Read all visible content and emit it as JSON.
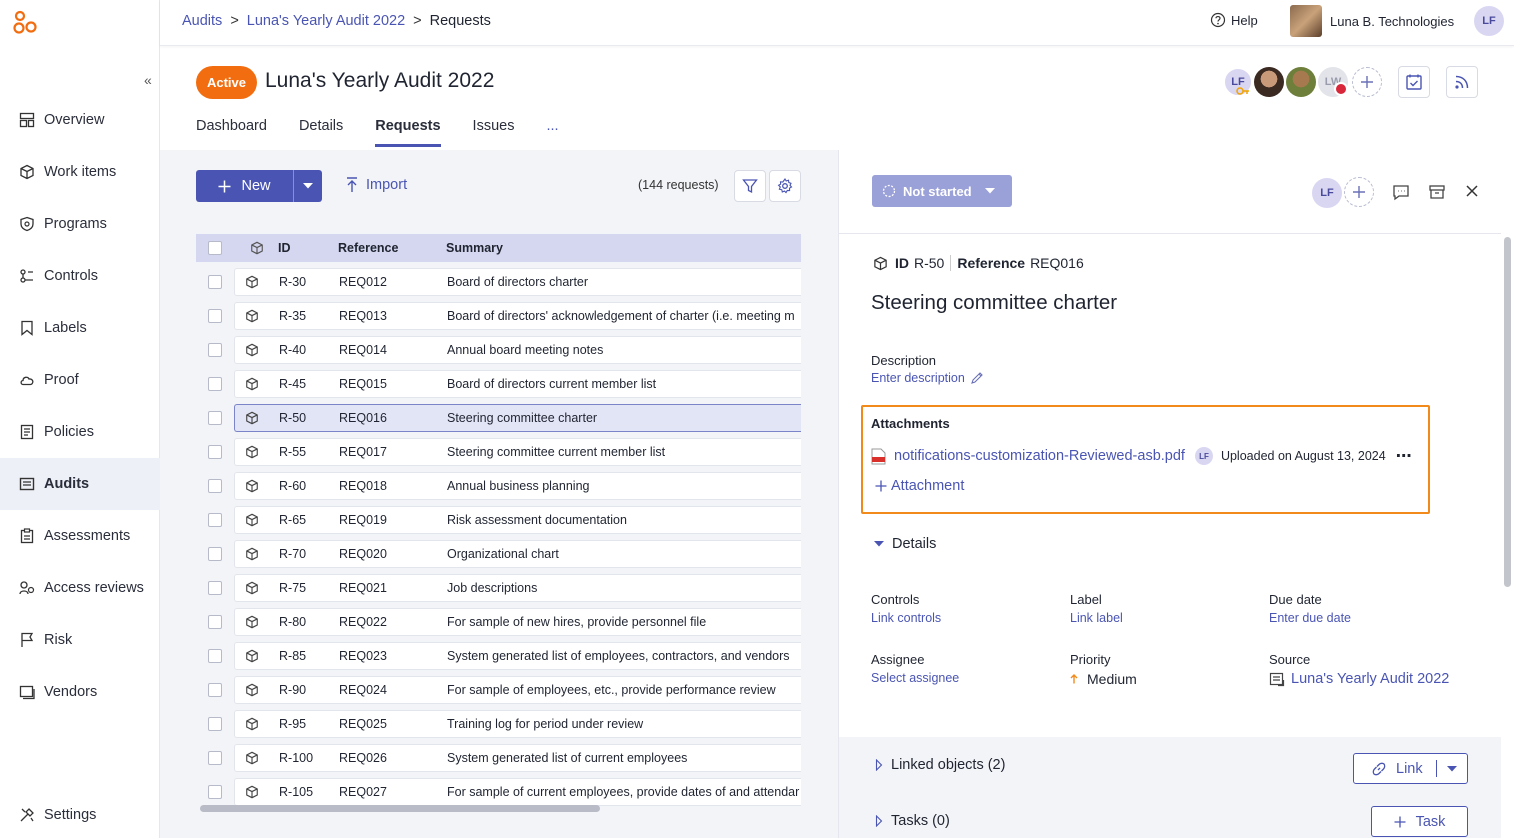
{
  "colors": {
    "accent": "#4a55b3",
    "active_badge": "#f26d10",
    "highlight": "#f28a1b",
    "status": "#9aa0d8"
  },
  "sidebar": {
    "collapse_icon": "«",
    "items": [
      {
        "label": "Overview",
        "icon": "overview-icon"
      },
      {
        "label": "Work items",
        "icon": "cube-icon"
      },
      {
        "label": "Programs",
        "icon": "shield-icon"
      },
      {
        "label": "Controls",
        "icon": "controls-icon"
      },
      {
        "label": "Labels",
        "icon": "bookmark-icon"
      },
      {
        "label": "Proof",
        "icon": "cloud-icon"
      },
      {
        "label": "Policies",
        "icon": "policy-icon"
      },
      {
        "label": "Audits",
        "icon": "audit-icon",
        "active": true
      },
      {
        "label": "Assessments",
        "icon": "clipboard-icon"
      },
      {
        "label": "Access reviews",
        "icon": "access-icon"
      },
      {
        "label": "Risk",
        "icon": "flag-icon"
      },
      {
        "label": "Vendors",
        "icon": "vendor-icon"
      }
    ],
    "settings": "Settings"
  },
  "topbar": {
    "breadcrumb": [
      "Audits",
      "Luna's Yearly Audit 2022",
      "Requests"
    ],
    "sep": ">",
    "help": "Help",
    "org": "Luna B. Technologies",
    "user_initials": "LF"
  },
  "header": {
    "status": "Active",
    "title": "Luna's Yearly Audit 2022",
    "tabs": [
      "Dashboard",
      "Details",
      "Requests",
      "Issues",
      "..."
    ],
    "active_tab": "Requests",
    "member_initials": [
      "LF",
      "LW"
    ]
  },
  "list": {
    "new_label": "New",
    "import_label": "Import",
    "count": "(144 requests)",
    "columns": {
      "id": "ID",
      "reference": "Reference",
      "summary": "Summary"
    },
    "rows": [
      {
        "id": "R-30",
        "ref": "REQ012",
        "summary": "Board of directors charter"
      },
      {
        "id": "R-35",
        "ref": "REQ013",
        "summary": "Board of directors' acknowledgement of charter (i.e. meeting m"
      },
      {
        "id": "R-40",
        "ref": "REQ014",
        "summary": "Annual board meeting notes"
      },
      {
        "id": "R-45",
        "ref": "REQ015",
        "summary": "Board of directors current member list"
      },
      {
        "id": "R-50",
        "ref": "REQ016",
        "summary": "Steering committee charter",
        "selected": true
      },
      {
        "id": "R-55",
        "ref": "REQ017",
        "summary": "Steering committee current member list"
      },
      {
        "id": "R-60",
        "ref": "REQ018",
        "summary": "Annual business planning"
      },
      {
        "id": "R-65",
        "ref": "REQ019",
        "summary": "Risk assessment documentation"
      },
      {
        "id": "R-70",
        "ref": "REQ020",
        "summary": "Organizational chart"
      },
      {
        "id": "R-75",
        "ref": "REQ021",
        "summary": "Job descriptions"
      },
      {
        "id": "R-80",
        "ref": "REQ022",
        "summary": "For sample of new hires, provide personnel file"
      },
      {
        "id": "R-85",
        "ref": "REQ023",
        "summary": "System generated list of employees, contractors, and vendors"
      },
      {
        "id": "R-90",
        "ref": "REQ024",
        "summary": "For sample of employees, etc., provide performance review"
      },
      {
        "id": "R-95",
        "ref": "REQ025",
        "summary": "Training log for period under review"
      },
      {
        "id": "R-100",
        "ref": "REQ026",
        "summary": "System generated list of current employees"
      },
      {
        "id": "R-105",
        "ref": "REQ027",
        "summary": "For sample of current employees, provide dates of and attendar"
      }
    ]
  },
  "detail": {
    "status": "Not started",
    "assignee_initials": "LF",
    "id_label": "ID",
    "id_value": "R-50",
    "ref_label": "Reference",
    "ref_value": "REQ016",
    "title": "Steering committee charter",
    "description_label": "Description",
    "description_placeholder": "Enter description",
    "attachments_label": "Attachments",
    "attachment": {
      "name": "notifications-customization-Reviewed-asb.pdf",
      "uploader": "LF",
      "uploaded": "Uploaded on August 13, 2024"
    },
    "add_attachment": "Attachment",
    "details_label": "Details",
    "fields": {
      "controls": {
        "label": "Controls",
        "value": "Link controls"
      },
      "label": {
        "label": "Label",
        "value": "Link label"
      },
      "due_date": {
        "label": "Due date",
        "value": "Enter due date"
      },
      "assignee": {
        "label": "Assignee",
        "value": "Select assignee"
      },
      "priority": {
        "label": "Priority",
        "value": "Medium"
      },
      "source": {
        "label": "Source",
        "value": "Luna's Yearly Audit 2022"
      }
    },
    "linked_objects": "Linked objects (2)",
    "link_button": "Link",
    "tasks": "Tasks (0)",
    "task_button": "Task"
  }
}
